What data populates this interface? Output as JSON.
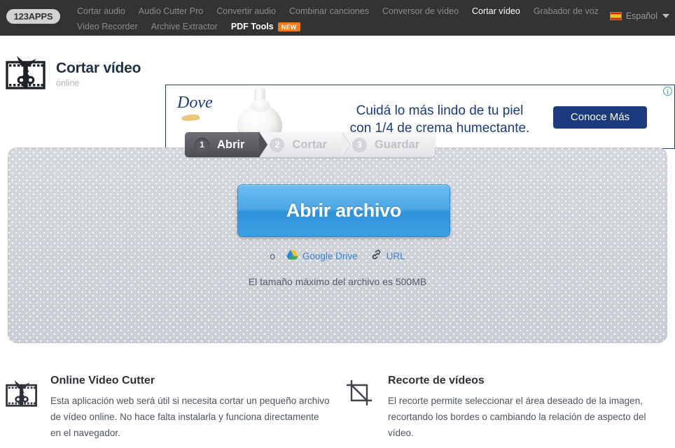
{
  "topbar": {
    "logo": "123APPS",
    "nav_row1": [
      {
        "label": "Cortar audio",
        "active": false
      },
      {
        "label": "Audio Cutter Pro",
        "active": false
      },
      {
        "label": "Convertir audio",
        "active": false
      },
      {
        "label": "Combinar canciones",
        "active": false
      },
      {
        "label": "Conversor de vídeo",
        "active": false
      },
      {
        "label": "Cortar vídeo",
        "active": true
      },
      {
        "label": "Grabador de voz",
        "active": false
      }
    ],
    "nav_row2": [
      {
        "label": "Video Recorder",
        "active": false
      },
      {
        "label": "Archive Extractor",
        "active": false
      },
      {
        "label": "PDF Tools",
        "active": true,
        "badge": "NEW"
      }
    ],
    "language": "Español",
    "language_flag": "spain-flag-icon"
  },
  "brand": {
    "title": "Cortar vídeo",
    "subtitle": "online",
    "logo_icon": "film-scissors-icon"
  },
  "ad": {
    "brand": "Dove",
    "headline_line1": "Cuidá lo más lindo de tu piel",
    "headline_line2": "con 1/4 de crema humectante.",
    "cta": "Conoce Más",
    "adchoices_icon": "info-circle-icon",
    "adchoices_label": "i"
  },
  "steps": [
    {
      "num": "1",
      "label": "Abrir",
      "active": true
    },
    {
      "num": "2",
      "label": "Cortar",
      "active": false
    },
    {
      "num": "3",
      "label": "Guardar",
      "active": false
    }
  ],
  "main": {
    "open_button": "Abrir archivo",
    "or_text": "o",
    "google_drive": "Google Drive",
    "google_drive_icon": "google-drive-icon",
    "url_label": "URL",
    "url_icon": "link-icon",
    "max_size_note": "El tamaño máximo del archivo es 500MB"
  },
  "features": [
    {
      "icon": "film-scissors-icon",
      "title": "Online Video Cutter",
      "text": "Esta aplicación web será útil si necesita cortar un pequeño archivo de vídeo online. No hace falta instalarla y funciona directamente en el navegador."
    },
    {
      "icon": "crop-icon",
      "title": "Recorte de vídeos",
      "text": "El recorte permite seleccionar el área deseado de la imagen, recortando los bordes o cambiando la relación de aspecto del vídeo."
    }
  ],
  "colors": {
    "topbar_bg": "#333333",
    "accent_blue": "#3ba0e2",
    "link_blue": "#3d80cc",
    "badge_orange": "#f07c1e",
    "ad_navy": "#1c3a7e",
    "panel_gray": "#cfd4da"
  }
}
